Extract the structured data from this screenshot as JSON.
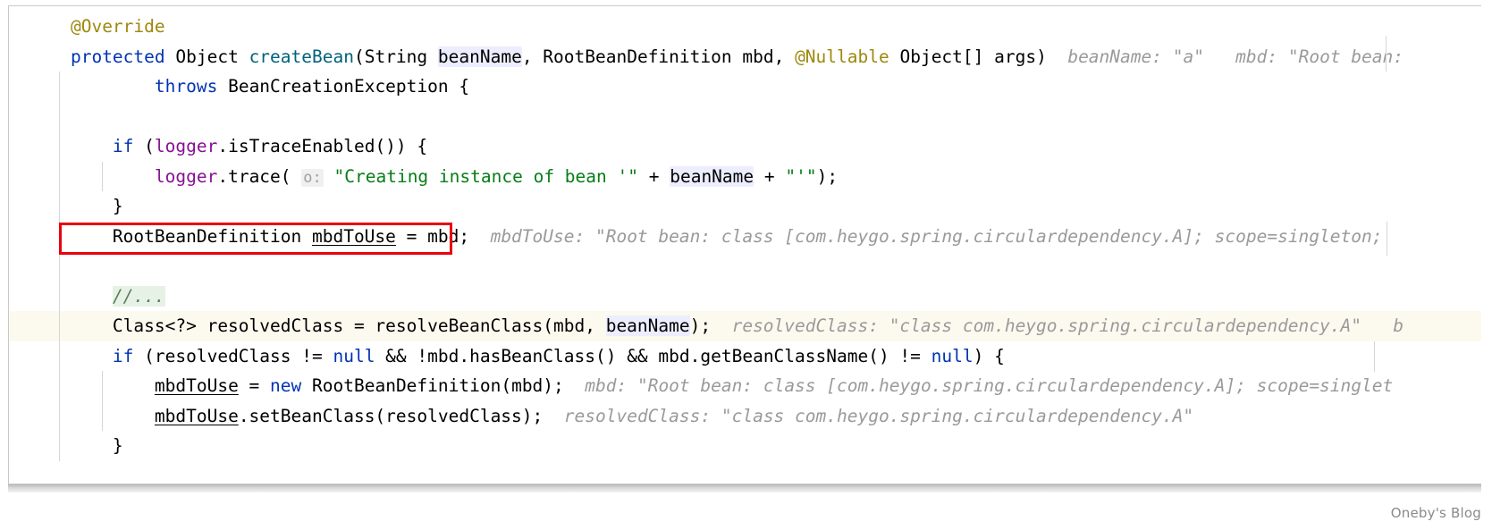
{
  "editor": {
    "language": "java",
    "watermark": "Oneby's Blog",
    "colors": {
      "keyword": "#0033b3",
      "annotation": "#9e880d",
      "method": "#00627a",
      "field": "#871094",
      "string": "#067d17",
      "inlay_hint": "#9a9a9a",
      "param_highlight_bg": "#eceeff",
      "comment_highlight_bg": "#e6f2e6",
      "caret_line_bg": "#fcfaef",
      "annotation_box_border": "#e8000d",
      "background": "#ffffff"
    },
    "annotation_box": {
      "label": "red-rectangle-highlight",
      "target_code": "RootBeanDefinition mbdToUse = mbd;"
    },
    "lines": [
      {
        "id": 1,
        "tokens": [
          {
            "text": "    ",
            "kind": "plain"
          },
          {
            "text": "@Override",
            "kind": "annotation"
          }
        ],
        "hint": ""
      },
      {
        "id": 2,
        "tokens": [
          {
            "text": "    ",
            "kind": "plain"
          },
          {
            "text": "protected",
            "kind": "keyword"
          },
          {
            "text": " Object ",
            "kind": "plain"
          },
          {
            "text": "createBean",
            "kind": "method"
          },
          {
            "text": "(String ",
            "kind": "plain"
          },
          {
            "text": "beanName",
            "kind": "param-highlight"
          },
          {
            "text": ", RootBeanDefinition mbd, ",
            "kind": "plain"
          },
          {
            "text": "@Nullable",
            "kind": "annotation"
          },
          {
            "text": " Object[] args)",
            "kind": "plain"
          }
        ],
        "hint": "beanName: \"a\"   mbd: \"Root bean:"
      },
      {
        "id": 3,
        "tokens": [
          {
            "text": "            ",
            "kind": "plain"
          },
          {
            "text": "throws",
            "kind": "keyword"
          },
          {
            "text": " BeanCreationException {",
            "kind": "plain"
          }
        ],
        "hint": ""
      },
      {
        "id": 4,
        "tokens": [],
        "hint": ""
      },
      {
        "id": 5,
        "tokens": [
          {
            "text": "        ",
            "kind": "plain"
          },
          {
            "text": "if",
            "kind": "keyword"
          },
          {
            "text": " (",
            "kind": "plain"
          },
          {
            "text": "logger",
            "kind": "field"
          },
          {
            "text": ".isTraceEnabled()) {",
            "kind": "plain"
          }
        ],
        "hint": ""
      },
      {
        "id": 6,
        "tokens": [
          {
            "text": "            ",
            "kind": "plain"
          },
          {
            "text": "logger",
            "kind": "field"
          },
          {
            "text": ".trace(",
            "kind": "plain"
          },
          {
            "text": " ",
            "kind": "plain"
          },
          {
            "text": "o:",
            "kind": "param-hint"
          },
          {
            "text": " ",
            "kind": "plain"
          },
          {
            "text": "\"Creating instance of bean '\"",
            "kind": "string"
          },
          {
            "text": " + ",
            "kind": "plain"
          },
          {
            "text": "beanName",
            "kind": "param-highlight"
          },
          {
            "text": " + ",
            "kind": "plain"
          },
          {
            "text": "\"'\"",
            "kind": "string"
          },
          {
            "text": ");",
            "kind": "plain"
          }
        ],
        "hint": ""
      },
      {
        "id": 7,
        "tokens": [
          {
            "text": "        }",
            "kind": "plain"
          }
        ],
        "hint": ""
      },
      {
        "id": 8,
        "tokens": [
          {
            "text": "        RootBeanDefinition ",
            "kind": "plain"
          },
          {
            "text": "mbdToUse",
            "kind": "underlined"
          },
          {
            "text": " = mbd;",
            "kind": "plain"
          }
        ],
        "hint": "mbdToUse: \"Root bean: class [com.heygo.spring.circulardependency.A]; scope=singleton;",
        "boxed": true
      },
      {
        "id": 9,
        "tokens": [],
        "hint": ""
      },
      {
        "id": 10,
        "tokens": [
          {
            "text": "        ",
            "kind": "plain"
          },
          {
            "text": "//...",
            "kind": "comment-highlight"
          }
        ],
        "hint": ""
      },
      {
        "id": 11,
        "tokens": [
          {
            "text": "        Class<?> resolvedClass = resolveBeanClass(mbd, ",
            "kind": "plain"
          },
          {
            "text": "beanName",
            "kind": "param-highlight"
          },
          {
            "text": ");",
            "kind": "plain"
          }
        ],
        "hint": "resolvedClass: \"class com.heygo.spring.circulardependency.A\"   b",
        "caret": true
      },
      {
        "id": 12,
        "tokens": [
          {
            "text": "        ",
            "kind": "plain"
          },
          {
            "text": "if",
            "kind": "keyword"
          },
          {
            "text": " (resolvedClass != ",
            "kind": "plain"
          },
          {
            "text": "null",
            "kind": "keyword"
          },
          {
            "text": " && !mbd.hasBeanClass() && mbd.getBeanClassName() != ",
            "kind": "plain"
          },
          {
            "text": "null",
            "kind": "keyword"
          },
          {
            "text": ") {",
            "kind": "plain"
          }
        ],
        "hint": ""
      },
      {
        "id": 13,
        "tokens": [
          {
            "text": "            ",
            "kind": "plain"
          },
          {
            "text": "mbdToUse",
            "kind": "underlined"
          },
          {
            "text": " = ",
            "kind": "plain"
          },
          {
            "text": "new",
            "kind": "keyword"
          },
          {
            "text": " RootBeanDefinition(mbd);",
            "kind": "plain"
          }
        ],
        "hint": "mbd: \"Root bean: class [com.heygo.spring.circulardependency.A]; scope=singlet"
      },
      {
        "id": 14,
        "tokens": [
          {
            "text": "            ",
            "kind": "plain"
          },
          {
            "text": "mbdToUse",
            "kind": "underlined"
          },
          {
            "text": ".setBeanClass(resolvedClass);",
            "kind": "plain"
          }
        ],
        "hint": "resolvedClass: \"class com.heygo.spring.circulardependency.A\""
      },
      {
        "id": 15,
        "tokens": [
          {
            "text": "        }",
            "kind": "plain"
          }
        ],
        "hint": ""
      }
    ]
  }
}
